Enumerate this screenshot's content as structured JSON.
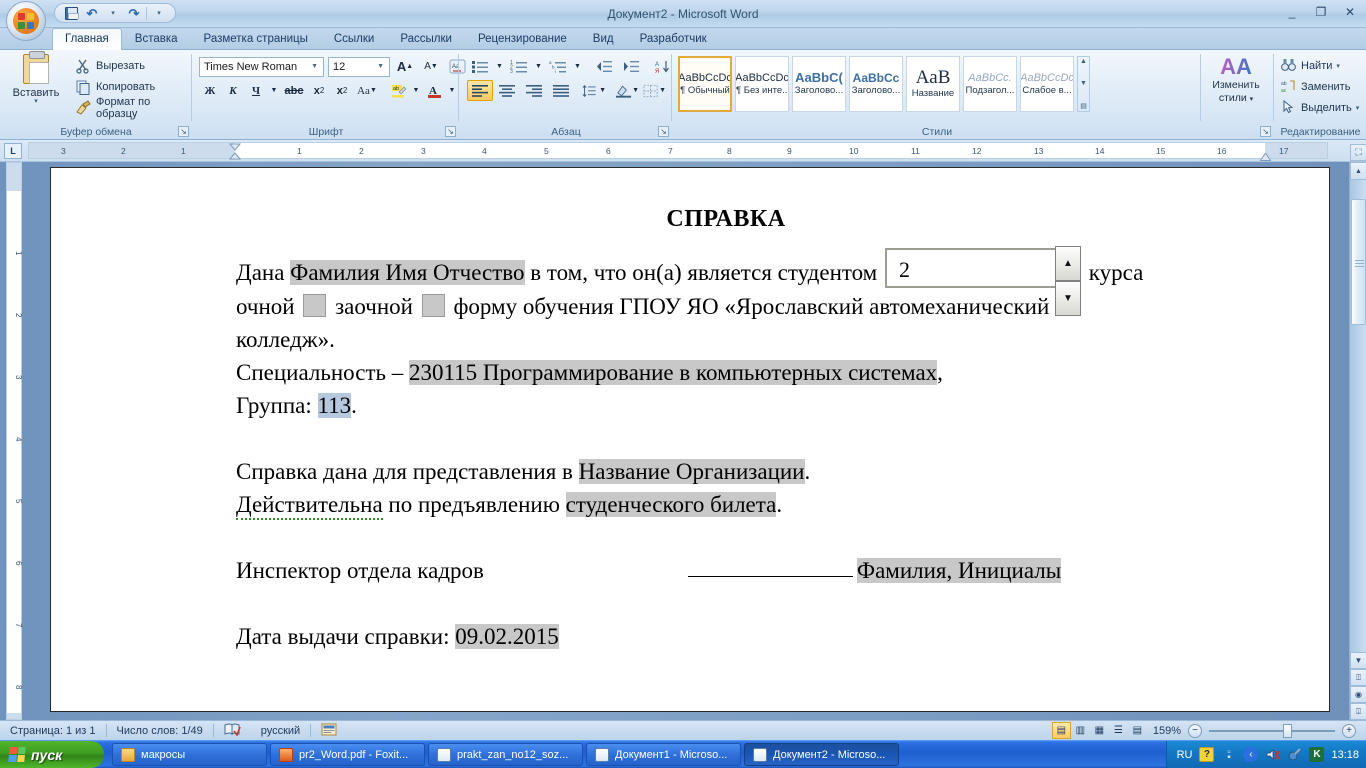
{
  "window": {
    "title": "Документ2 - Microsoft Word",
    "minimize": "_",
    "maximize": "❐",
    "close": "✕"
  },
  "quick_access": {
    "save": "save-icon",
    "undo": "↶",
    "undo_caret": "▾",
    "redo": "↷",
    "customize": "▾"
  },
  "tabs": [
    {
      "label": "Главная",
      "active": true
    },
    {
      "label": "Вставка",
      "active": false
    },
    {
      "label": "Разметка страницы",
      "active": false
    },
    {
      "label": "Ссылки",
      "active": false
    },
    {
      "label": "Рассылки",
      "active": false
    },
    {
      "label": "Рецензирование",
      "active": false
    },
    {
      "label": "Вид",
      "active": false
    },
    {
      "label": "Разработчик",
      "active": false
    }
  ],
  "ribbon": {
    "clipboard": {
      "group_label": "Буфер обмена",
      "paste": "Вставить",
      "paste_caret": "▾",
      "cut": "Вырезать",
      "copy": "Копировать",
      "format_painter": "Формат по образцу"
    },
    "font": {
      "group_label": "Шрифт",
      "font_name": "Times New Roman",
      "font_size": "12",
      "grow_font": "A",
      "shrink_font": "A",
      "clear_formatting": "Aa",
      "bold": "Ж",
      "italic": "К",
      "underline": "Ч",
      "underline_caret": "▾",
      "strikethrough": "abc",
      "subscript": "x₂",
      "superscript": "x²",
      "change_case": "Aa",
      "change_case_caret": "▾",
      "highlight": "ab",
      "highlight_caret": "▾",
      "font_color": "A",
      "font_color_caret": "▾"
    },
    "paragraph": {
      "group_label": "Абзац",
      "bullets": "▪≡",
      "numbering": "1≡",
      "multilevel": "a≡",
      "decrease_indent": "⇤≡",
      "increase_indent": "⇥≡",
      "sort": "A↓",
      "show_marks": "¶",
      "align_left": "≡",
      "align_center": "≡",
      "align_right": "≡",
      "justify": "≡",
      "line_spacing": "↕≡",
      "shading": "▨",
      "borders": "⊞"
    },
    "styles": {
      "group_label": "Стили",
      "items": [
        {
          "sample": "AaBbCcDc",
          "name": "¶ Обычный",
          "active": true
        },
        {
          "sample": "AaBbCcDc",
          "name": "¶ Без инте...",
          "active": false
        },
        {
          "sample": "AaBbC(",
          "name": "Заголово...",
          "active": false
        },
        {
          "sample": "AaBbCc",
          "name": "Заголово...",
          "active": false
        },
        {
          "sample": "AaB",
          "name": "Название",
          "active": false
        },
        {
          "sample": "AaBbCc.",
          "name": "Подзагол...",
          "active": false
        },
        {
          "sample": "AaBbCcDc",
          "name": "Слабое в...",
          "active": false
        }
      ],
      "scroll_up": "▲",
      "scroll_down": "▼",
      "more": "▤"
    },
    "change_styles": {
      "label_line1": "Изменить",
      "label_line2": "стили",
      "caret": "▾",
      "icon": "AA"
    },
    "editing": {
      "group_label": "Редактирование",
      "find": "Найти",
      "find_caret": "▾",
      "replace": "Заменить",
      "select": "Выделить",
      "select_caret": "▾"
    }
  },
  "ruler": {
    "tab_selector": "L",
    "h_ticks": [
      "3",
      "2",
      "1",
      "1",
      "2",
      "3",
      "4",
      "5",
      "6",
      "7",
      "8",
      "9",
      "10",
      "11",
      "12",
      "13",
      "14",
      "15",
      "16",
      "17"
    ],
    "v_ticks": [
      "1",
      "2",
      "3",
      "4",
      "5",
      "6",
      "7",
      "8"
    ]
  },
  "document": {
    "title": "СПРАВКА",
    "line1_a": "Дана ",
    "line1_field": "Фамилия Имя Отчество",
    "line1_b": " в том, что он(а) является студентом ",
    "course_value": "2",
    "spin_up": "▲",
    "spin_down": "▼",
    "line1_c": " курса",
    "line2_a": "очной ",
    "line2_b": " заочной ",
    "line2_c": " форму обучения ГПОУ ЯО «Ярославский автомеханический",
    "line3": "колледж».",
    "line4_a": "Специальность – ",
    "line4_field": "230115 Программирование в компьютерных системах",
    "line4_b": ",",
    "line5_a": "Группа: ",
    "line5_field": "113",
    "line5_b": ".",
    "line6_a": "Справка дана для представления в ",
    "line6_field": "Название Организации",
    "line6_b": ".",
    "line7_a": "Действительна",
    "line7_b": " по предъявлению ",
    "line7_field": "студенческого билета",
    "line7_c": ".",
    "line8_a": "Инспектор отдела кадров",
    "line8_field": "Фамилия, Инициалы",
    "line9_a": "Дата выдачи справки: ",
    "line9_field": "09.02.2015"
  },
  "status_bar": {
    "page": "Страница: 1 из 1",
    "words": "Число слов: 1/49",
    "proofing_icon": "spell-check-icon",
    "language": "русский",
    "macro_icon": "macro-record-icon",
    "views": [
      {
        "name": "print-layout",
        "glyph": "▤",
        "active": true
      },
      {
        "name": "full-screen-reading",
        "glyph": "▥",
        "active": false
      },
      {
        "name": "web-layout",
        "glyph": "▦",
        "active": false
      },
      {
        "name": "outline",
        "glyph": "☰",
        "active": false
      },
      {
        "name": "draft",
        "glyph": "▤",
        "active": false
      }
    ],
    "zoom": "159%",
    "zoom_out": "−",
    "zoom_in": "+"
  },
  "taskbar": {
    "start": "пуск",
    "items": [
      {
        "label": "макросы",
        "icon_color": "#f5c451",
        "active": false
      },
      {
        "label": "pr2_Word.pdf - Foxit...",
        "icon_color": "#e86a2a",
        "active": false
      },
      {
        "label": "prakt_zan_no12_soz...",
        "icon_color": "#4a7ec4",
        "active": false
      },
      {
        "label": "Документ1 - Microso...",
        "icon_color": "#4a7ec4",
        "active": false
      },
      {
        "label": "Документ2 - Microso...",
        "icon_color": "#4a7ec4",
        "active": true
      }
    ],
    "tray": {
      "language": "RU",
      "icons": [
        "help-icon",
        "network-icon",
        "volume-icon",
        "kaspersky-icon"
      ],
      "clock": "13:18"
    }
  },
  "colors": {
    "accent": "#2f70da",
    "highlight_gray": "#c8c8c8",
    "selection_blue": "#b6c8de",
    "ribbon_blue": "#cbdff2"
  }
}
